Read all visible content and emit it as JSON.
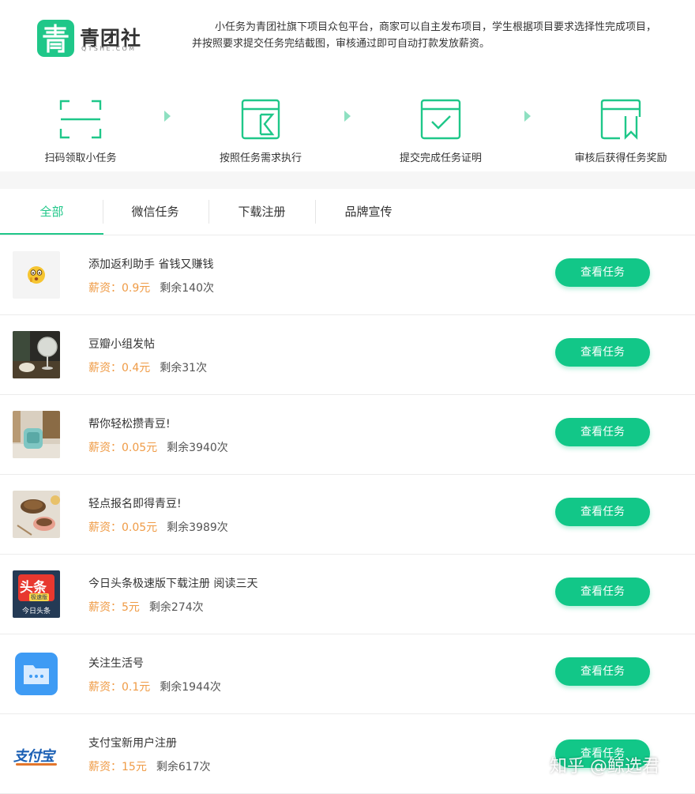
{
  "header": {
    "logo_text": "青团社",
    "logo_sub": "QTSHE.COM",
    "intro": "小任务为青团社旗下项目众包平台，商家可以自主发布项目，学生根据项目要求选择性完成项目，并按照要求提交任务完结截图，审核通过即可自动打款发放薪资。"
  },
  "steps": [
    {
      "label": "扫码领取小任务",
      "icon": "scan-icon"
    },
    {
      "label": "按照任务需求执行",
      "icon": "hourglass-icon"
    },
    {
      "label": "提交完成任务证明",
      "icon": "checkbox-icon"
    },
    {
      "label": "审核后获得任务奖励",
      "icon": "reward-bookmark-icon"
    }
  ],
  "tabs": [
    {
      "label": "全部",
      "active": true
    },
    {
      "label": "微信任务",
      "active": false
    },
    {
      "label": "下载注册",
      "active": false
    },
    {
      "label": "品牌宣传",
      "active": false
    }
  ],
  "tasks": [
    {
      "title": "添加返利助手 省钱又赚钱",
      "salary": "薪资：0.9元",
      "remaining": "剩余140次",
      "button": "查看任务",
      "thumb": "emoji-thumbnail"
    },
    {
      "title": "豆瓣小组发帖",
      "salary": "薪资：0.4元",
      "remaining": "剩余31次",
      "button": "查看任务",
      "thumb": "fan-photo-thumbnail"
    },
    {
      "title": "帮你轻松攒青豆!",
      "salary": "薪资：0.05元",
      "remaining": "剩余3940次",
      "button": "查看任务",
      "thumb": "gadget-photo-thumbnail"
    },
    {
      "title": "轻点报名即得青豆!",
      "salary": "薪资：0.05元",
      "remaining": "剩余3989次",
      "button": "查看任务",
      "thumb": "food-photo-thumbnail"
    },
    {
      "title": "今日头条极速版下载注册 阅读三天",
      "salary": "薪资：5元",
      "remaining": "剩余274次",
      "button": "查看任务",
      "thumb": "toutiao-app-icon",
      "thumb_text": "头条",
      "thumb_badge": "极速版",
      "thumb_caption": "今日头条"
    },
    {
      "title": "关注生活号",
      "salary": "薪资：0.1元",
      "remaining": "剩余1944次",
      "button": "查看任务",
      "thumb": "chat-folder-icon"
    },
    {
      "title": "支付宝新用户注册",
      "salary": "薪资：15元",
      "remaining": "剩余617次",
      "button": "查看任务",
      "thumb": "alipay-logo",
      "thumb_text": "支付宝"
    }
  ],
  "watermark": "知乎 @鲸选君",
  "colors": {
    "accent": "#1fc789",
    "button": "#12c788",
    "salary": "#ef9b46"
  }
}
